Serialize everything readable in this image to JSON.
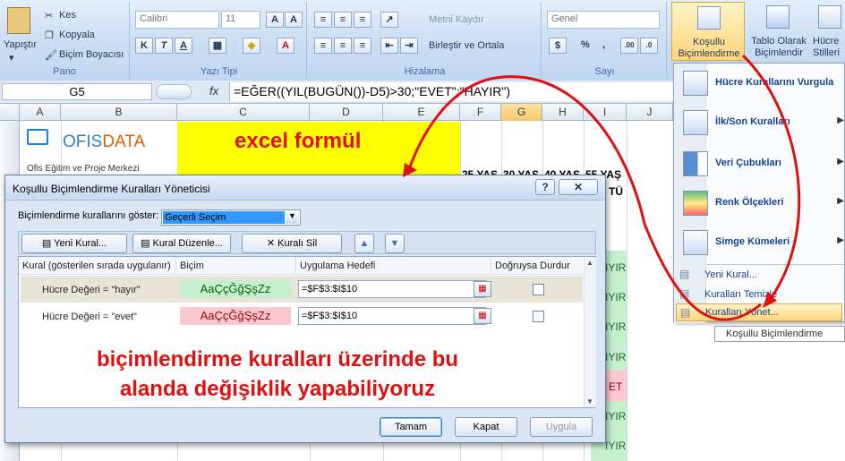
{
  "ribbon": {
    "clipboard": {
      "paste": "Yapıştır",
      "cut": "Kes",
      "copy": "Kopyala",
      "format_painter": "Biçim Boyacısı",
      "title": "Pano"
    },
    "font": {
      "name": "Calibri",
      "size": "11",
      "title": "Yazı Tipi",
      "bold": "K",
      "italic": "T",
      "underline": "A",
      "color": "A"
    },
    "alignment": {
      "wrap": "Metni Kaydır",
      "merge": "Birleştir ve Ortala",
      "title": "Hizalama"
    },
    "number": {
      "format": "Genel",
      "percent": "%",
      "comma": ",",
      "title": "Sayı"
    },
    "styles": {
      "conditional": "Koşullu\nBiçimlendirme",
      "conditional_l1": "Koşullu",
      "conditional_l2": "Biçimlendirme",
      "table_l1": "Tablo Olarak",
      "table_l2": "Biçimlendir",
      "cell_l1": "Hücre",
      "cell_l2": "Stilleri"
    }
  },
  "formula_bar": {
    "name_box": "G5",
    "fx": "fx",
    "formula": "=EĞER((YIL(BUGÜN())-D5)>30;\"EVET\";\"HAYIR\")"
  },
  "columns": [
    "A",
    "B",
    "C",
    "D",
    "E",
    "F",
    "G",
    "H",
    "I",
    "J"
  ],
  "sheet": {
    "logo_text_a": "OFIS",
    "logo_text_b": "DATA",
    "company": "Ofis Eğitim ve Proje Merkezi",
    "banner": "excel formül",
    "hdr_f": "25 YAŞ",
    "hdr_g": "30 YAŞ",
    "hdr_h": "40 YAŞ",
    "hdr_i": "55 YAŞ",
    "hdr_i2": "TÜ",
    "right_cells": [
      "IYIR",
      "IYIR",
      "IYIR",
      "IYIR",
      "IYIR",
      "IYIR",
      "ET",
      "IYIR",
      "IYIR"
    ]
  },
  "dialog": {
    "title": "Koşullu Biçimlendirme Kuralları Yöneticisi",
    "help": "?",
    "show_label": "Biçimlendirme kurallarını göster:",
    "show_value": "Geçerli Seçim",
    "new_rule": "Yeni Kural...",
    "edit_rule": "Kural Düzenle...",
    "delete_rule": "Kuralı Sil",
    "headers": {
      "rule": "Kural (gösterilen sırada uygulanır)",
      "format": "Biçim",
      "applies": "Uygulama Hedefi",
      "stop": "Doğruysa Durdur"
    },
    "rules": [
      {
        "rule": "Hücre Değeri = \"hayır\"",
        "preview": "AaÇçĞğŞşZz",
        "applies": "=$F$3:$I$10"
      },
      {
        "rule": "Hücre Değeri = \"evet\"",
        "preview": "AaÇçĞğŞşZz",
        "applies": "=$F$3:$I$10"
      }
    ],
    "ok": "Tamam",
    "close": "Kapat",
    "apply": "Uygula"
  },
  "menu": {
    "items": [
      "Hücre Kurallarını Vurgula",
      "İlk/Son Kuralları",
      "Veri Çubukları",
      "Renk Ölçekleri",
      "Simge Kümeleri"
    ],
    "new_rule": "Yeni Kural...",
    "clear_rules": "Kuralları Temizle",
    "manage_rules": "Kuralları Yönet...",
    "tooltip": "Koşullu Biçimlendirme"
  },
  "annotation": {
    "line1": "biçimlendirme kuralları üzerinde bu",
    "line2": "alanda değişiklik yapabiliyoruz"
  },
  "colors": {
    "red_annotation": "#e01010",
    "banner_yellow": "#ffff00",
    "green_preview": "#c6efce",
    "red_preview": "#ffc7ce"
  }
}
